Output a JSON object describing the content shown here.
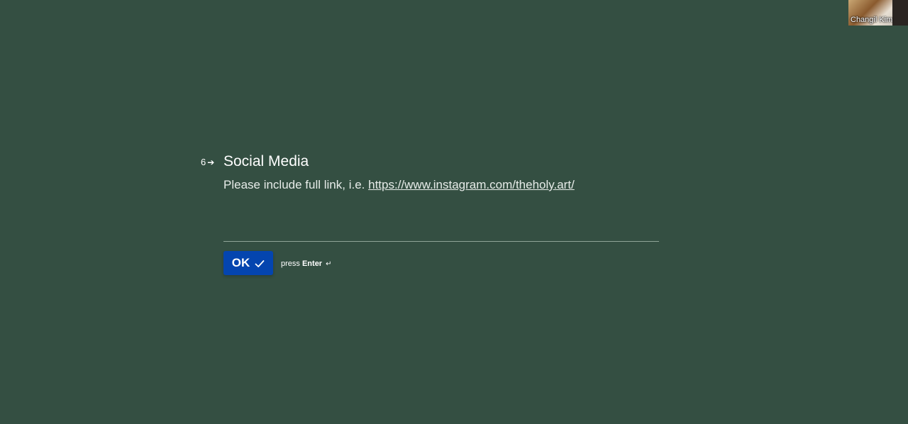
{
  "question": {
    "number": "6",
    "title": "Social Media",
    "description_prefix": "Please include full link, i.e. ",
    "description_link": "https://www.instagram.com/theholy.art/",
    "answer_value": "",
    "answer_placeholder": ""
  },
  "actions": {
    "ok_label": "OK",
    "press_label": "press",
    "enter_label": "Enter",
    "return_glyph": "↵"
  },
  "video_tile": {
    "participant_name": "Changil Kim"
  },
  "colors": {
    "background": "#344f42",
    "button": "#0445af",
    "input_border": "#8fa598"
  },
  "icons": {
    "question_arrow": "arrow-right-icon",
    "ok_check": "check-icon",
    "enter_return": "return-icon"
  }
}
